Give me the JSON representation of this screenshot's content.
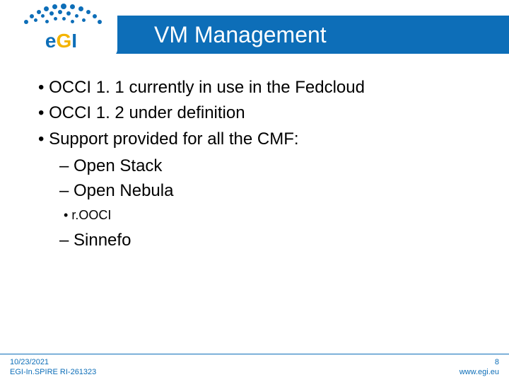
{
  "header": {
    "title": "VM Management"
  },
  "logo": {
    "text_e": "e",
    "text_g": "G",
    "text_i": "I"
  },
  "bullets": {
    "level1": [
      "OCCI 1. 1 currently in use in the Fedcloud",
      "OCCI 1. 2 under definition",
      "Support provided for all the CMF:"
    ],
    "level2_a": [
      "Open Stack",
      "Open Nebula"
    ],
    "level3": [
      "r.OOCI"
    ],
    "level2_b": [
      "Sinnefo"
    ]
  },
  "footer": {
    "date": "10/23/2021",
    "project": "EGI-In.SPIRE RI-261323",
    "page": "8",
    "url": "www.egi.eu"
  }
}
